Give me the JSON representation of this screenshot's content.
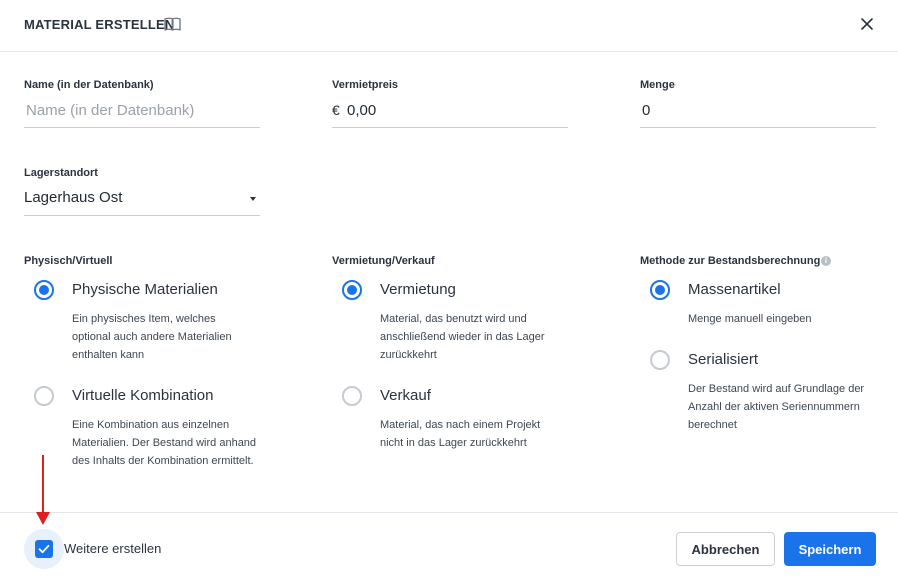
{
  "header": {
    "title": "MATERIAL ERSTELLEN",
    "book_icon": "book-open-icon",
    "close_icon": "close-icon"
  },
  "fields": {
    "name": {
      "label": "Name (in der Datenbank)",
      "value": "",
      "placeholder": "Name (in der Datenbank)"
    },
    "price": {
      "label": "Vermietpreis",
      "prefix": "€",
      "value": "0,00"
    },
    "quantity": {
      "label": "Menge",
      "value": "0"
    },
    "location": {
      "label": "Lagerstandort",
      "value": "Lagerhaus Ost"
    }
  },
  "groups": {
    "physical": {
      "label": "Physisch/Virtuell",
      "options": [
        {
          "label": "Physische Materialien",
          "description": "Ein physisches Item, welches optional auch andere Materialien enthalten kann",
          "checked": true
        },
        {
          "label": "Virtuelle Kombination",
          "description": "Eine Kombination aus einzelnen Materialien. Der Bestand wird anhand des Inhalts der Kombination ermittelt.",
          "checked": false
        }
      ]
    },
    "rental": {
      "label": "Vermietung/Verkauf",
      "options": [
        {
          "label": "Vermietung",
          "description": "Material, das benutzt wird und anschließend wieder in das Lager zurückkehrt",
          "checked": true
        },
        {
          "label": "Verkauf",
          "description": "Material, das nach einem Projekt nicht in das Lager zurückkehrt",
          "checked": false
        }
      ]
    },
    "method": {
      "label": "Methode zur Bestandsberechnung",
      "info_icon": "info-icon",
      "options": [
        {
          "label": "Massenartikel",
          "description": "Menge manuell eingeben",
          "checked": true
        },
        {
          "label": "Serialisiert",
          "description": "Der Bestand wird auf Grundlage der Anzahl der aktiven Seriennummern berechnet",
          "checked": false
        }
      ]
    }
  },
  "footer": {
    "create_more_label": "Weitere erstellen",
    "create_more_checked": true,
    "cancel_label": "Abbrechen",
    "save_label": "Speichern"
  },
  "colors": {
    "accent": "#1a73e8",
    "annotation_arrow": "#e02020"
  }
}
